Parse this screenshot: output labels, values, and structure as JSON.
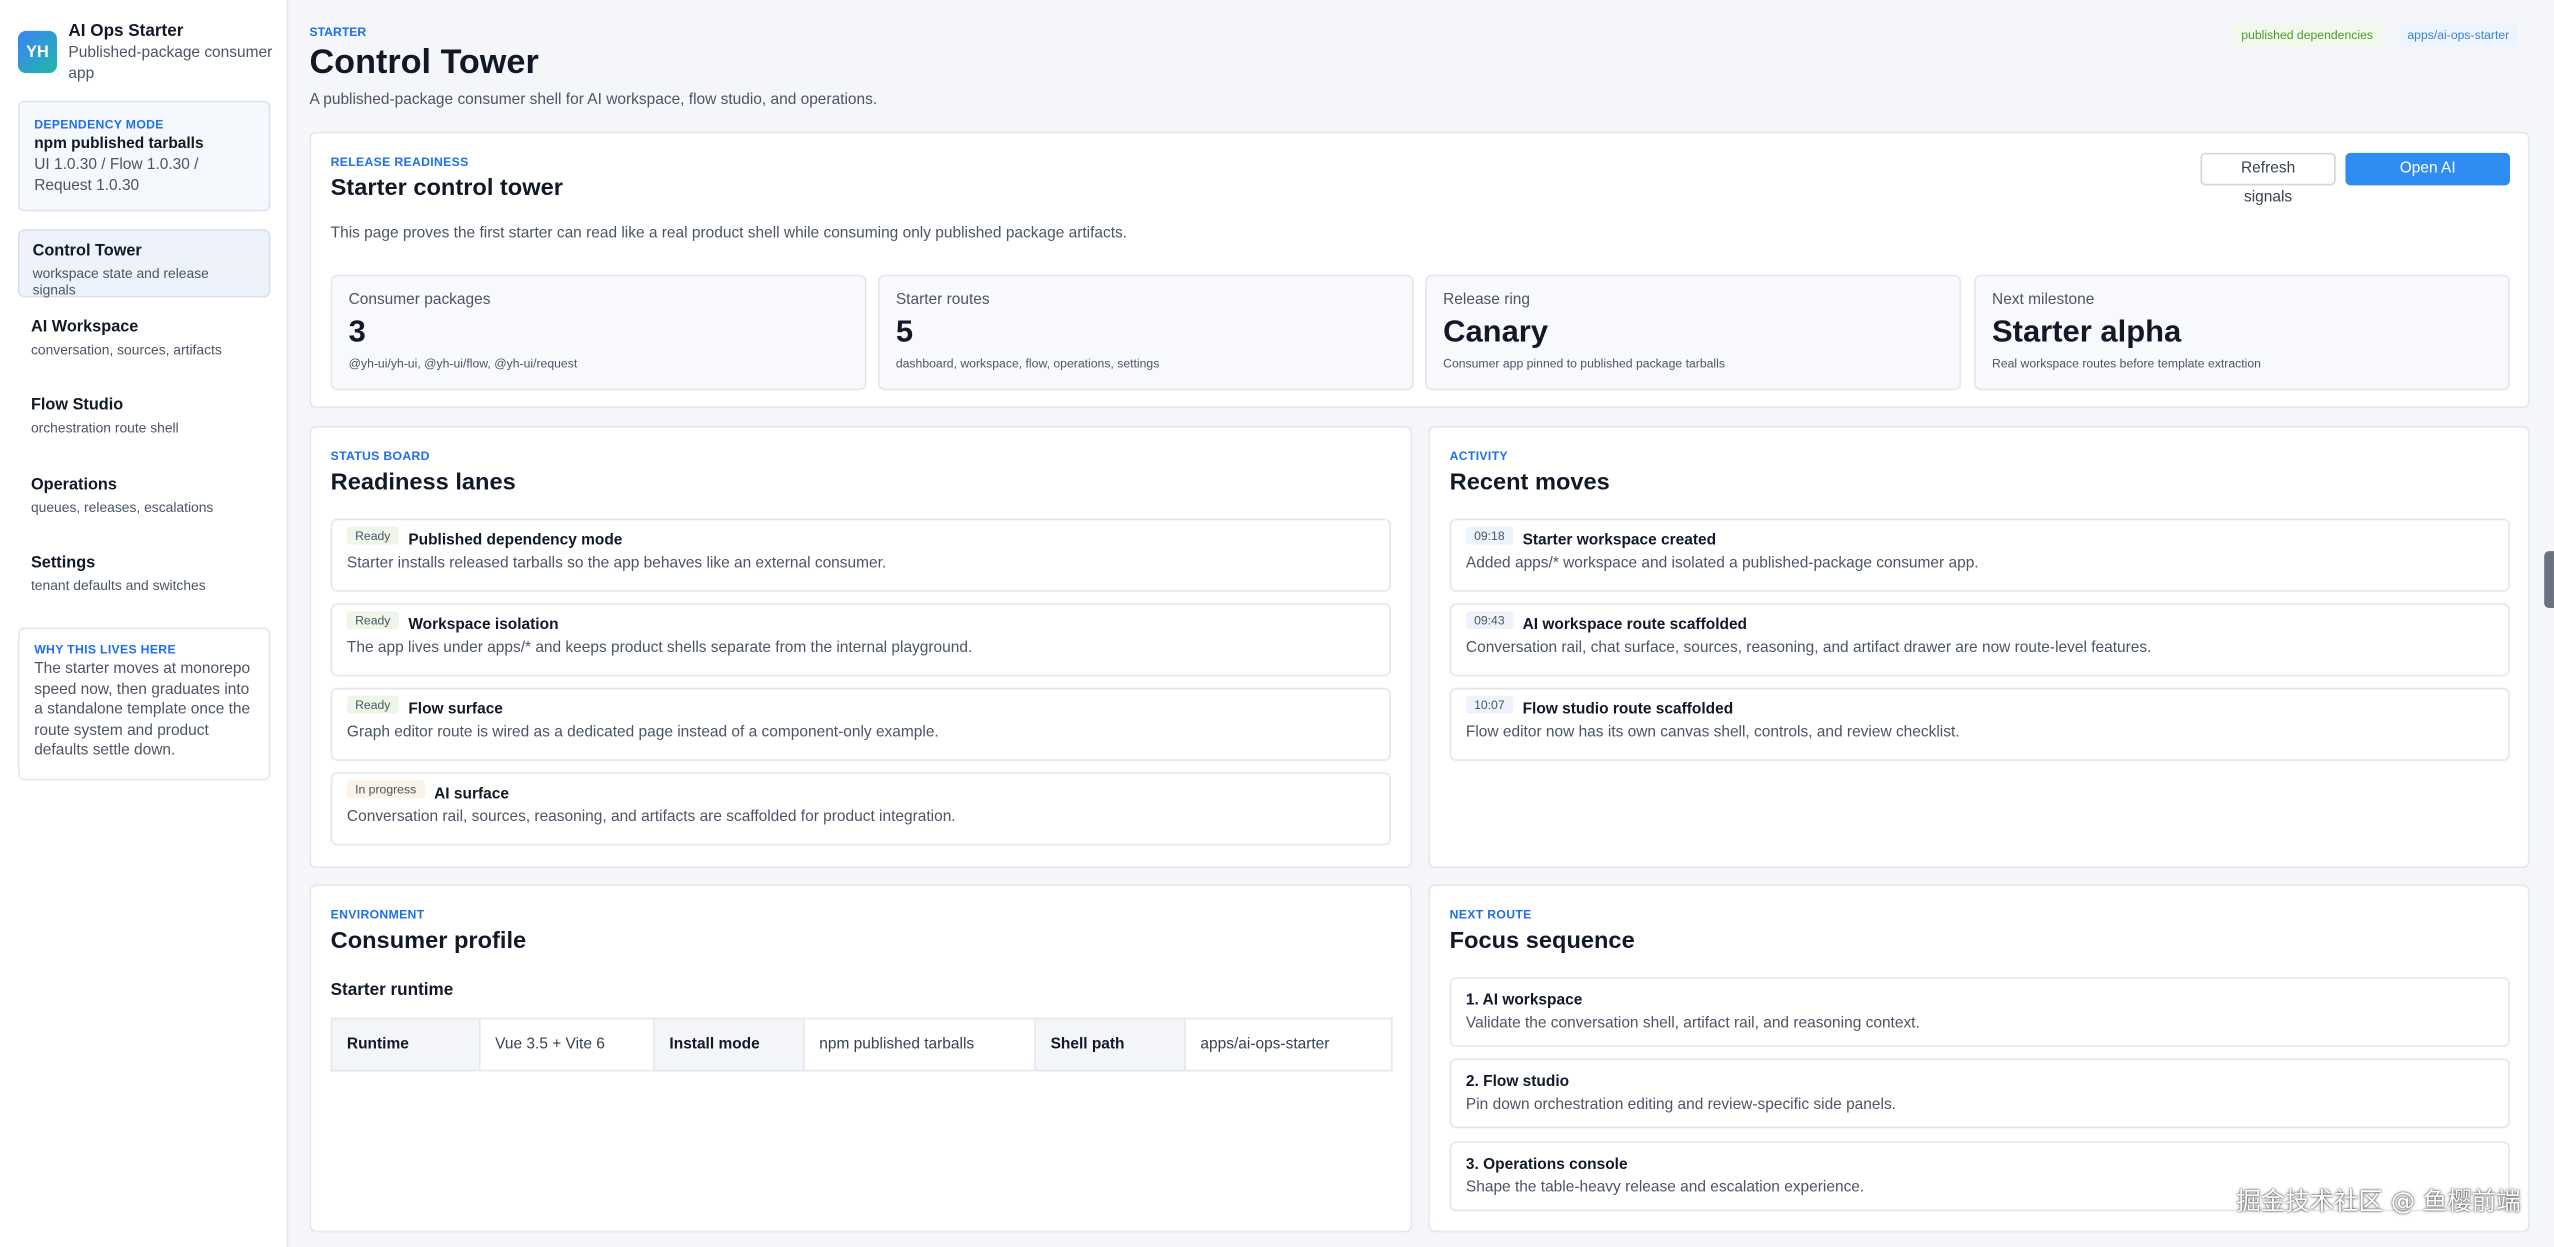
{
  "brand": {
    "avatar_initials": "YH",
    "name": "AI Ops Starter",
    "subtitle": "Published-package consumer app"
  },
  "dependency": {
    "eyebrow": "DEPENDENCY MODE",
    "title": "npm published tarballs",
    "versions": "UI 1.0.30 / Flow 1.0.30 / Request 1.0.30"
  },
  "nav": [
    {
      "title": "Control Tower",
      "subtitle": "workspace state and release signals",
      "active": true
    },
    {
      "title": "AI Workspace",
      "subtitle": "conversation, sources, artifacts",
      "active": false
    },
    {
      "title": "Flow Studio",
      "subtitle": "orchestration route shell",
      "active": false
    },
    {
      "title": "Operations",
      "subtitle": "queues, releases, escalations",
      "active": false
    },
    {
      "title": "Settings",
      "subtitle": "tenant defaults and switches",
      "active": false
    }
  ],
  "why": {
    "eyebrow": "WHY THIS LIVES HERE",
    "text": "The starter moves at monorepo speed now, then graduates into a standalone template once the route system and product defaults settle down."
  },
  "header": {
    "eyebrow": "STARTER",
    "title": "Control Tower",
    "description": "A published-package consumer shell for AI workspace, flow studio, and operations.",
    "chips": [
      "published dependencies",
      "apps/ai-ops-starter"
    ]
  },
  "release": {
    "eyebrow": "RELEASE READINESS",
    "title": "Starter control tower",
    "description": "This page proves the first starter can read like a real product shell while consuming only published package artifacts.",
    "refresh_label": "Refresh signals",
    "open_label": "Open AI workspace",
    "metrics": [
      {
        "label": "Consumer packages",
        "value": "3",
        "note": "@yh-ui/yh-ui, @yh-ui/flow, @yh-ui/request"
      },
      {
        "label": "Starter routes",
        "value": "5",
        "note": "dashboard, workspace, flow, operations, settings"
      },
      {
        "label": "Release ring",
        "value": "Canary",
        "note": "Consumer app pinned to published package tarballs"
      },
      {
        "label": "Next milestone",
        "value": "Starter alpha",
        "note": "Real workspace routes before template extraction"
      }
    ]
  },
  "status_board": {
    "eyebrow": "STATUS BOARD",
    "title": "Readiness lanes",
    "lanes": [
      {
        "tag": "Ready",
        "title": "Published dependency mode",
        "text": "Starter installs released tarballs so the app behaves like an external consumer."
      },
      {
        "tag": "Ready",
        "title": "Workspace isolation",
        "text": "The app lives under apps/* and keeps product shells separate from the internal playground."
      },
      {
        "tag": "Ready",
        "title": "Flow surface",
        "text": "Graph editor route is wired as a dedicated page instead of a component-only example."
      },
      {
        "tag": "In progress",
        "title": "AI surface",
        "text": "Conversation rail, sources, reasoning, and artifacts are scaffolded for product integration."
      }
    ]
  },
  "activity": {
    "eyebrow": "ACTIVITY",
    "title": "Recent moves",
    "items": [
      {
        "time": "09:18",
        "title": "Starter workspace created",
        "text": "Added apps/* workspace and isolated a published-package consumer app."
      },
      {
        "time": "09:43",
        "title": "AI workspace route scaffolded",
        "text": "Conversation rail, chat surface, sources, reasoning, and artifact drawer are now route-level features."
      },
      {
        "time": "10:07",
        "title": "Flow studio route scaffolded",
        "text": "Flow editor now has its own canvas shell, controls, and review checklist."
      }
    ]
  },
  "environment": {
    "eyebrow": "ENVIRONMENT",
    "title": "Consumer profile",
    "subtitle": "Starter runtime",
    "rows": [
      {
        "key": "Runtime",
        "value": "Vue 3.5 + Vite 6"
      },
      {
        "key": "Install mode",
        "value": "npm published tarballs"
      },
      {
        "key": "Shell path",
        "value": "apps/ai-ops-starter"
      }
    ]
  },
  "next_route": {
    "eyebrow": "NEXT ROUTE",
    "title": "Focus sequence",
    "items": [
      {
        "title": "1. AI workspace",
        "text": "Validate the conversation shell, artifact rail, and reasoning context."
      },
      {
        "title": "2. Flow studio",
        "text": "Pin down orchestration editing and review-specific side panels."
      },
      {
        "title": "3. Operations console",
        "text": "Shape the table-heavy release and escalation experience."
      }
    ]
  },
  "watermark": "掘金技术社区 @ 鱼樱前端",
  "colors": {
    "accent": "#2f8cf0",
    "eyebrow": "#1f6feb",
    "ready_tag": "#eef6ea",
    "progress_tag": "#fbf2e8",
    "chip_green_text": "#4c9a2a",
    "chip_blue_text": "#3b82d6"
  }
}
